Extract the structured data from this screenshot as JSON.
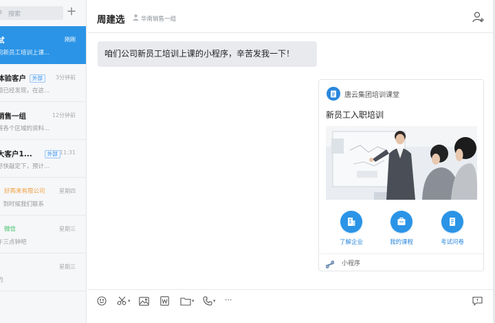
{
  "sidebar": {
    "search_placeholder": "搜索",
    "add_icon": "plus-icon",
    "conversations": [
      {
        "name": "试",
        "time": "刚刚",
        "preview": "司新员工培训上课...",
        "active": true
      },
      {
        "name": "体验客户",
        "tag": "外部",
        "time": "3分钟前",
        "preview": "题已经发现，在这..."
      },
      {
        "name": "销售一组",
        "time": "12分钟前",
        "preview": "将各个区域的资料..."
      },
      {
        "name": "大客户1...",
        "tag": "外部",
        "time": "11:31",
        "preview": "尽快敲定下，预计..."
      },
      {
        "org": "好再来有限公司",
        "org_color": "#f0a040",
        "time": "星期四",
        "preview": "，到时候我们联系"
      },
      {
        "org": "微信",
        "org_color": "#3bbf63",
        "time": "星期三",
        "preview": "午三点钟吧"
      },
      {
        "time": "星期三",
        "preview": "的"
      }
    ]
  },
  "header": {
    "title": "周建选",
    "subtitle": "华南销售一组",
    "add_member_icon": "add-member-icon"
  },
  "message": {
    "text": "咱们公司新员工培训上课的小程序，辛苦发我一下！"
  },
  "card": {
    "app_name": "唐云集团培训课堂",
    "title": "新员工入职培训",
    "actions": [
      {
        "label": "了解企业",
        "icon": "building-icon"
      },
      {
        "label": "我的课程",
        "icon": "course-icon"
      },
      {
        "label": "考试问卷",
        "icon": "exam-icon"
      }
    ],
    "footer_label": "小程序"
  },
  "colors": {
    "accent": "#2b94e6",
    "tag_blue": "#3a8ee6",
    "sidebar_bg": "#f6f7f9",
    "bubble_bg": "#e8eaee"
  },
  "toolbar": {
    "icons": [
      "emoji-icon",
      "scissors-icon",
      "image-icon",
      "word-doc-icon",
      "folder-icon",
      "phone-icon",
      "more-icon",
      "chat-record-icon"
    ],
    "more_label": "···"
  }
}
